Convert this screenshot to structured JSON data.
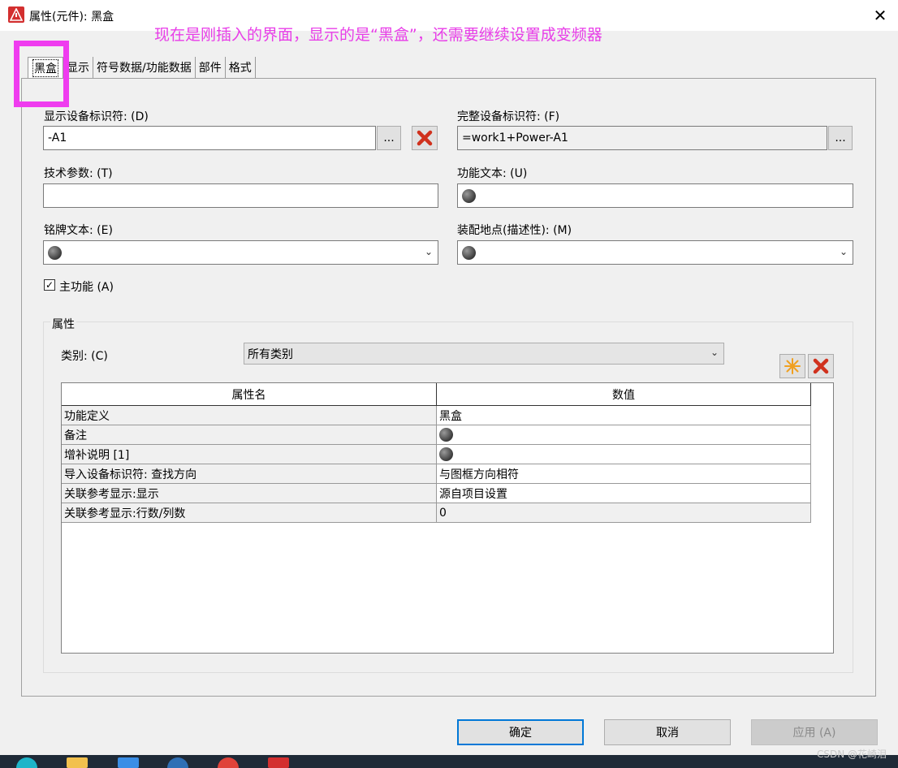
{
  "window": {
    "title": "属性(元件): 黑盒",
    "close_glyph": "✕"
  },
  "annotation": "现在是刚插入的界面，显示的是“黑盒”，还需要继续设置成变频器",
  "tabs": [
    "黑盒",
    "显示",
    "符号数据/功能数据",
    "部件",
    "格式"
  ],
  "fields": {
    "display_id_label": "显示设备标识符: (D)",
    "display_id_value": "-A1",
    "full_id_label": "完整设备标识符: (F)",
    "full_id_value": "=work1+Power-A1",
    "tech_param_label": "技术参数: (T)",
    "func_text_label": "功能文本: (U)",
    "nameplate_label": "铭牌文本: (E)",
    "mount_loc_label": "装配地点(描述性): (M)",
    "main_func_label": "主功能 (A)",
    "dots": "...",
    "checkmark": "✓"
  },
  "properties": {
    "group_label": "属性",
    "category_label": "类别: (C)",
    "category_value": "所有类别",
    "columns": [
      "属性名",
      "数值"
    ],
    "rows": [
      {
        "name": "功能定义",
        "value": "黑盒"
      },
      {
        "name": "备注",
        "value": ""
      },
      {
        "name": "增补说明 [1]",
        "value": ""
      },
      {
        "name": "导入设备标识符: 查找方向",
        "value": "与图框方向相符"
      },
      {
        "name": "关联参考显示:显示",
        "value": "源自项目设置"
      },
      {
        "name": "关联参考显示:行数/列数",
        "value": "0"
      }
    ]
  },
  "buttons": {
    "ok": "确定",
    "cancel": "取消",
    "apply": "应用 (A)"
  },
  "watermark": "CSDN @花崎泪",
  "colors": {
    "accent": "#0078d7",
    "annotation": "#e83ee8",
    "danger": "#d0311d",
    "new": "#f0a020"
  }
}
